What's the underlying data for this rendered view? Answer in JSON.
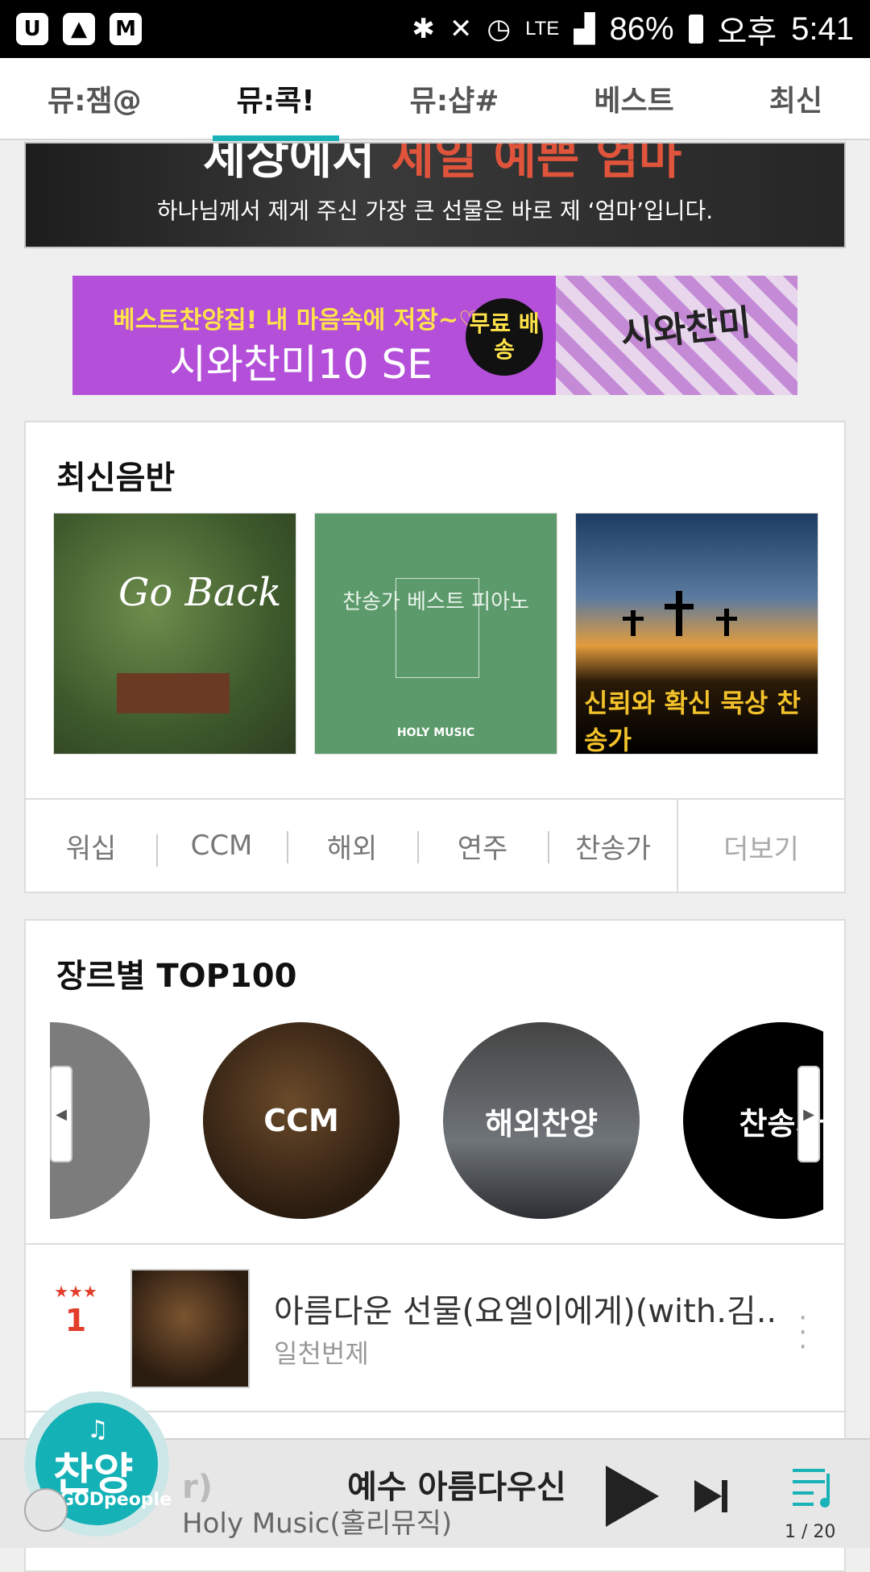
{
  "status_bar": {
    "left_icons": [
      "U+",
      "image",
      "M"
    ],
    "network": "LTE",
    "battery": "86%",
    "ampm": "오후",
    "time": "5:41"
  },
  "tabs": [
    {
      "label": "뮤:잼@"
    },
    {
      "label": "뮤:콕!"
    },
    {
      "label": "뮤:샵#"
    },
    {
      "label": "베스트"
    },
    {
      "label": "최신"
    }
  ],
  "hero": {
    "title_white": "세상에서",
    "title_red": "제일 예쁜 엄마",
    "subtitle": "하나님께서 제게 주신 가장 큰 선물은 바로 제 ‘엄마’입니다."
  },
  "promo": {
    "line1": "베스트찬양집! 내 마음속에 저장~♡",
    "line2": "시와찬미10 SE",
    "badge": "무료 배송",
    "cover_title": "시와찬미"
  },
  "new_albums": {
    "title": "최신음반",
    "albums": [
      {
        "art_text": "Go Back"
      },
      {
        "art_text": "찬송가 베스트 피아노",
        "label": "HOLY MUSIC"
      },
      {
        "art_text": "신뢰와 확신 묵상 찬송가"
      }
    ],
    "categories": [
      "워십",
      "CCM",
      "해외",
      "연주",
      "찬송가"
    ],
    "more": "더보기"
  },
  "genre_top": {
    "title": "장르별 TOP100",
    "genres": [
      "",
      "CCM",
      "해외찬양",
      "찬송가"
    ]
  },
  "ranking": [
    {
      "rank": "1",
      "title": "아름다운 선물(요엘이에게)(with.김..",
      "artist": "일천번제"
    }
  ],
  "player": {
    "title_prefix": "r)",
    "title": "예수 아름다우신",
    "artist": "Holy Music(홀리뮤직)",
    "queue": "1 / 20"
  },
  "fab": {
    "text": "찬양",
    "sub": "GODpeople"
  },
  "colors": {
    "accent": "#19b2b7",
    "rank_red": "#e33d2c",
    "promo_purple": "#b34fd9"
  }
}
